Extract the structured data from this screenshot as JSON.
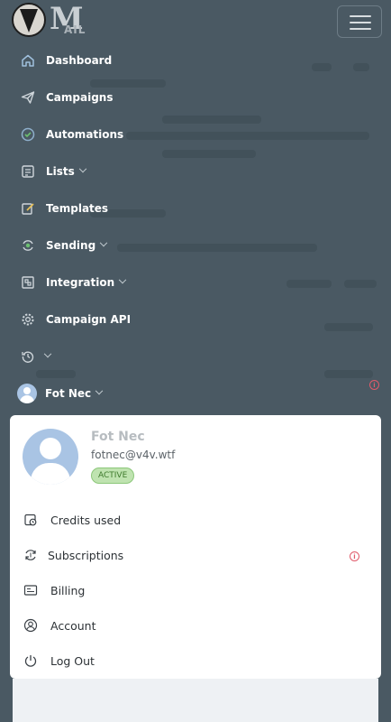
{
  "brand": {
    "logo_text": "M",
    "logo_sub": "AIL"
  },
  "nav": {
    "items": [
      {
        "label": "Dashboard",
        "icon": "home-icon"
      },
      {
        "label": "Campaigns",
        "icon": "paper-plane-icon"
      },
      {
        "label": "Automations",
        "icon": "shield-check-icon"
      },
      {
        "label": "Lists",
        "icon": "list-icon"
      },
      {
        "label": "Templates",
        "icon": "edit-icon"
      },
      {
        "label": "Sending",
        "icon": "sending-icon"
      },
      {
        "label": "Integration",
        "icon": "integration-icon"
      },
      {
        "label": "Campaign API",
        "icon": "gear-api-icon"
      },
      {
        "label": "",
        "icon": "history-icon"
      },
      {
        "label": "Fot Nec",
        "icon": "avatar"
      }
    ]
  },
  "profile": {
    "name": "Fot Nec",
    "email": "fotnec@v4v.wtf",
    "status": "ACTIVE",
    "menu": [
      {
        "label": "Credits used",
        "icon": "credits-icon"
      },
      {
        "label": "Subscriptions",
        "icon": "subscriptions-icon"
      },
      {
        "label": "Billing",
        "icon": "billing-icon"
      },
      {
        "label": "Account",
        "icon": "account-icon"
      },
      {
        "label": "Log Out",
        "icon": "power-icon"
      }
    ]
  },
  "alerts": {
    "info_symbol": "i"
  }
}
